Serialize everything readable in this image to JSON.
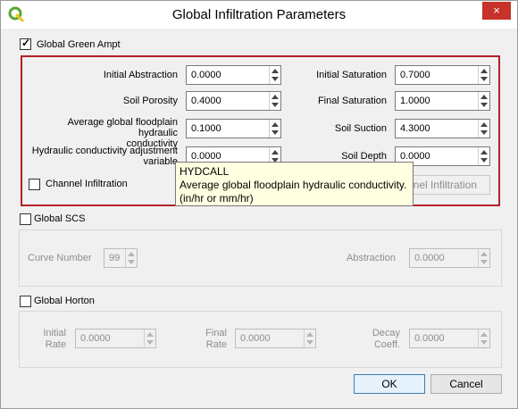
{
  "window": {
    "title": "Global Infiltration Parameters",
    "close_icon": "×"
  },
  "green_ampt": {
    "checkbox_label": "Global Green Ampt",
    "checked": true,
    "initial_abstraction": {
      "label": "Initial Abstraction",
      "value": "0.0000"
    },
    "soil_porosity": {
      "label": "Soil Porosity",
      "value": "0.4000"
    },
    "floodplain_conductivity": {
      "label_line1": "Average global floodplain hydraulic",
      "label_line2": "conductivity",
      "value": "0.1000"
    },
    "conductivity_adjustment": {
      "label_line1": "Hydraulic conductivity adjustment",
      "label_line2": "variable",
      "value": "0.0000"
    },
    "initial_saturation": {
      "label": "Initial Saturation",
      "value": "0.7000"
    },
    "final_saturation": {
      "label": "Final Saturation",
      "value": "1.0000"
    },
    "soil_suction": {
      "label": "Soil Suction",
      "value": "4.3000"
    },
    "soil_depth": {
      "label": "Soil Depth",
      "value": "0.0000"
    },
    "channel_infiltration_label": "Channel Infiltration",
    "channel_infiltration_button": "nnel Infiltration"
  },
  "tooltip": {
    "title": "HYDCALL",
    "line1": "Average global floodplain hydraulic conductivity.",
    "line2": "(in/hr or mm/hr)"
  },
  "scs": {
    "checkbox_label": "Global SCS",
    "curve_number": {
      "label": "Curve Number",
      "value": "99"
    },
    "abstraction": {
      "label": "Abstraction",
      "value": "0.0000"
    }
  },
  "horton": {
    "checkbox_label": "Global Horton",
    "initial_rate": {
      "label_line1": "Initial",
      "label_line2": "Rate",
      "value": "0.0000"
    },
    "final_rate": {
      "label_line1": "Final",
      "label_line2": "Rate",
      "value": "0.0000"
    },
    "decay_coeff": {
      "label_line1": "Decay",
      "label_line2": "Coeff.",
      "value": "0.0000"
    }
  },
  "buttons": {
    "ok": "OK",
    "cancel": "Cancel"
  },
  "colors": {
    "highlight_border": "#b52027",
    "tooltip_bg": "#ffffe1",
    "close_bg": "#c7322a",
    "qgis_green": "#59a82e"
  }
}
